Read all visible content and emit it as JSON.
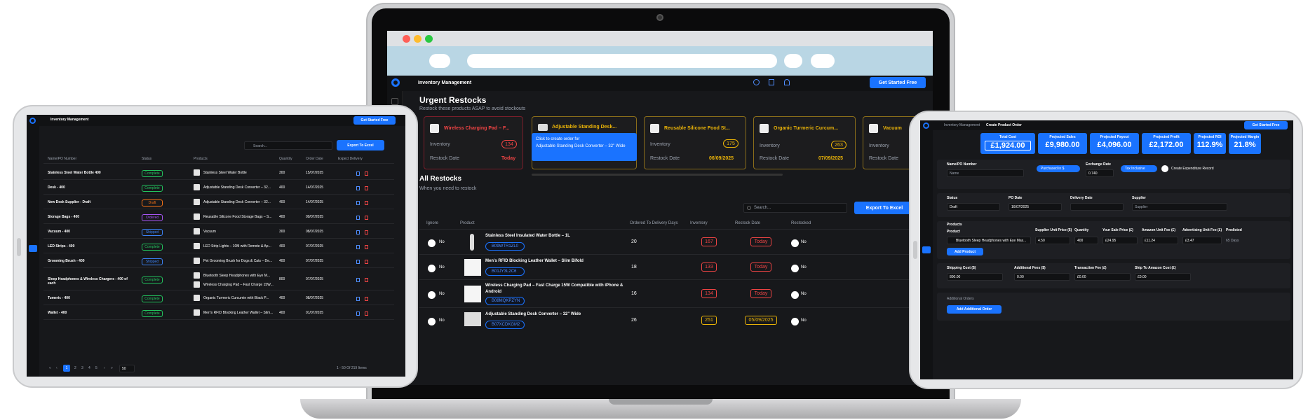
{
  "laptop": {
    "app_title": "Inventory Management",
    "cta": "Get Started Free",
    "urgent_title": "Urgent Restocks",
    "urgent_sub": "Restock these products ASAP to avoid stockouts",
    "urgent_cards": [
      {
        "name": "Wireless Charging Pad – F...",
        "inventory_label": "Inventory",
        "inventory": "134",
        "restock_label": "Restock Date",
        "restock": "Today"
      },
      {
        "name": "Adjustable Standing Desk...",
        "tooltip_line1": "Click to create order for",
        "tooltip_line2": "Adjustable Standing Desk Converter – 32\" Wide"
      },
      {
        "name": "Reusable Silicone Food St...",
        "inventory_label": "Inventory",
        "inventory": "175",
        "restock_label": "Restock Date",
        "restock": "06/09/2025"
      },
      {
        "name": "Organic Turmeric Curcum...",
        "inventory_label": "Inventory",
        "inventory": "263",
        "restock_label": "Restock Date",
        "restock": "07/09/2025"
      },
      {
        "name": "Vacuum",
        "inventory_label": "Inventory",
        "restock_label": "Restock Date"
      }
    ],
    "all_title": "All Restocks",
    "all_sub": "When you need to restock",
    "search_placeholder": "Search...",
    "export": "Export To Excel",
    "columns": [
      "Ignore",
      "Product",
      "Ordered To Delivery Days",
      "Inventory",
      "Restock Date",
      "Restocked"
    ],
    "rows": [
      {
        "toggle": "No",
        "name": "Stainless Steel Insulated Water Bottle – 1L",
        "asin": "B09WTR1ZL0",
        "days": "20",
        "inventory": "167",
        "restock": "Today",
        "restocked": "No"
      },
      {
        "toggle": "No",
        "name": "Men's RFID Blocking Leather Wallet – Slim Bifold",
        "asin": "B01JY3L2C6",
        "days": "18",
        "inventory": "133",
        "restock": "Today",
        "restocked": "No"
      },
      {
        "toggle": "No",
        "name": "Wireless Charging Pad – Fast Charge 15W Compatible with iPhone & Android",
        "asin": "B08MQKPZYN",
        "days": "16",
        "inventory": "134",
        "restock": "Today",
        "restocked": "No"
      },
      {
        "toggle": "No",
        "name": "Adjustable Standing Desk Converter – 32\" Wide",
        "asin": "B07XCDKGM2",
        "days": "26",
        "inventory": "251",
        "restock": "05/09/2025",
        "restocked": "No"
      }
    ]
  },
  "tablet_left": {
    "app_title": "Inventory Management",
    "cta": "Get Started Free",
    "search_placeholder": "Search...",
    "export": "Export To Excel",
    "columns": [
      "Name/PO Number",
      "Status",
      "Products",
      "Quantity",
      "Order Date",
      "Expect Delivery"
    ],
    "rows": [
      {
        "name": "Stainless Steel Water Bottle 400",
        "status": "Complete",
        "product": "Stainless Steel Water Bottle",
        "qty": "300",
        "date": "15/07/2025"
      },
      {
        "name": "Desk - 400",
        "status": "Complete",
        "product": "Adjustable Standing Desk Converter – 32...",
        "qty": "400",
        "date": "14/07/2025"
      },
      {
        "name": "New Desk Supplier - Draft",
        "status": "Draft",
        "product": "Adjustable Standing Desk Converter – 32...",
        "qty": "400",
        "date": "14/07/2025"
      },
      {
        "name": "Storage Bags - 400",
        "status": "Ordered",
        "product": "Reusable Silicone Food Storage Bags – S...",
        "qty": "400",
        "date": "09/07/2025"
      },
      {
        "name": "Vacuum - 400",
        "status": "Shipped",
        "product": "Vacuum",
        "qty": "300",
        "date": "08/07/2025"
      },
      {
        "name": "LED Strips - 400",
        "status": "Complete",
        "product": "LED Strip Lights – 10M with Remote & Ap...",
        "qty": "400",
        "date": "07/07/2025"
      },
      {
        "name": "Grooming Brush - 400",
        "status": "Shipped",
        "product": "Pet Grooming Brush for Dogs & Cats – De...",
        "qty": "400",
        "date": "07/07/2025"
      },
      {
        "name": "Sleep Headphones & Wireless Chargers - 400 of each",
        "status": "Complete",
        "product": "Bluetooth Sleep Headphones with Eye M...",
        "product2": "Wireless Charging Pad – Fast Charge 15W...",
        "qty": "800",
        "date": "07/07/2025"
      },
      {
        "name": "Tumeric - 400",
        "status": "Complete",
        "product": "Organic Turmeric Curcumin with Black P...",
        "qty": "400",
        "date": "08/07/2025"
      },
      {
        "name": "Wallet - 400",
        "status": "Complete",
        "product": "Men's RFID Blocking Leather Wallet – Slim...",
        "qty": "400",
        "date": "01/07/2025"
      }
    ],
    "pager": {
      "pages": [
        "1",
        "2",
        "3",
        "4",
        "5"
      ],
      "page_size": "50",
      "summary": "1 - 50 Of 219 Items"
    }
  },
  "tablet_right": {
    "breadcrumb_1": "Inventory Management",
    "breadcrumb_2": "Create Product Order",
    "cta": "Get Started Free",
    "stats": [
      {
        "label": "Total Cost",
        "value": "£1,924.00"
      },
      {
        "label": "Projected Sales",
        "value": "£9,980.00"
      },
      {
        "label": "Projected Payout",
        "value": "£4,096.00"
      },
      {
        "label": "Projected Profit",
        "value": "£2,172.00"
      },
      {
        "label": "Projected ROI",
        "value": "112.9%"
      },
      {
        "label": "Projected Margin",
        "value": "21.8%"
      }
    ],
    "name_label": "Name/PO Number",
    "name_placeholder": "Name",
    "purchased_label": "Purchased in $",
    "exchange_label": "Exchange Rate",
    "exchange_value": "0.740",
    "tax_label": "Tax Inclusive",
    "expenditure_label": "Create Expenditure Record",
    "status_label": "Status",
    "status_value": "Draft",
    "po_date_label": "PO Date",
    "po_date_value": "16/07/2025",
    "delivery_label": "Delivery Date",
    "supplier_label": "Supplier",
    "supplier_placeholder": "Supplier",
    "products_label": "Products",
    "product_col": "Product",
    "cols": [
      "Supplier Unit Price ($)",
      "Quantity",
      "Your Sale Price (£)",
      "Amazon Unit Fee (£)",
      "Advertising Unit Fee (£)",
      "Predicted"
    ],
    "product_value": "Bluetooth Sleep Headphones with Eye Mas...",
    "vals": [
      "4.50",
      "400",
      "£24.95",
      "£11.24",
      "£3.47",
      "65 Days"
    ],
    "add_product": "Add Product",
    "cost_cols": [
      "Shipping Cost ($)",
      "Additional Fees ($)",
      "Transaction Fee (£)",
      "Ship To Amazon Cost (£)"
    ],
    "cost_vals": [
      "800.00",
      "0.00",
      "£0.00",
      "£0.00"
    ],
    "additional_label": "Additional Orders",
    "add_additional": "Add Additional Order"
  },
  "colors": {
    "accent": "#1a73ff",
    "danger": "#ef4444",
    "warning": "#eab308",
    "success": "#22c55e",
    "bg": "#17181b"
  }
}
